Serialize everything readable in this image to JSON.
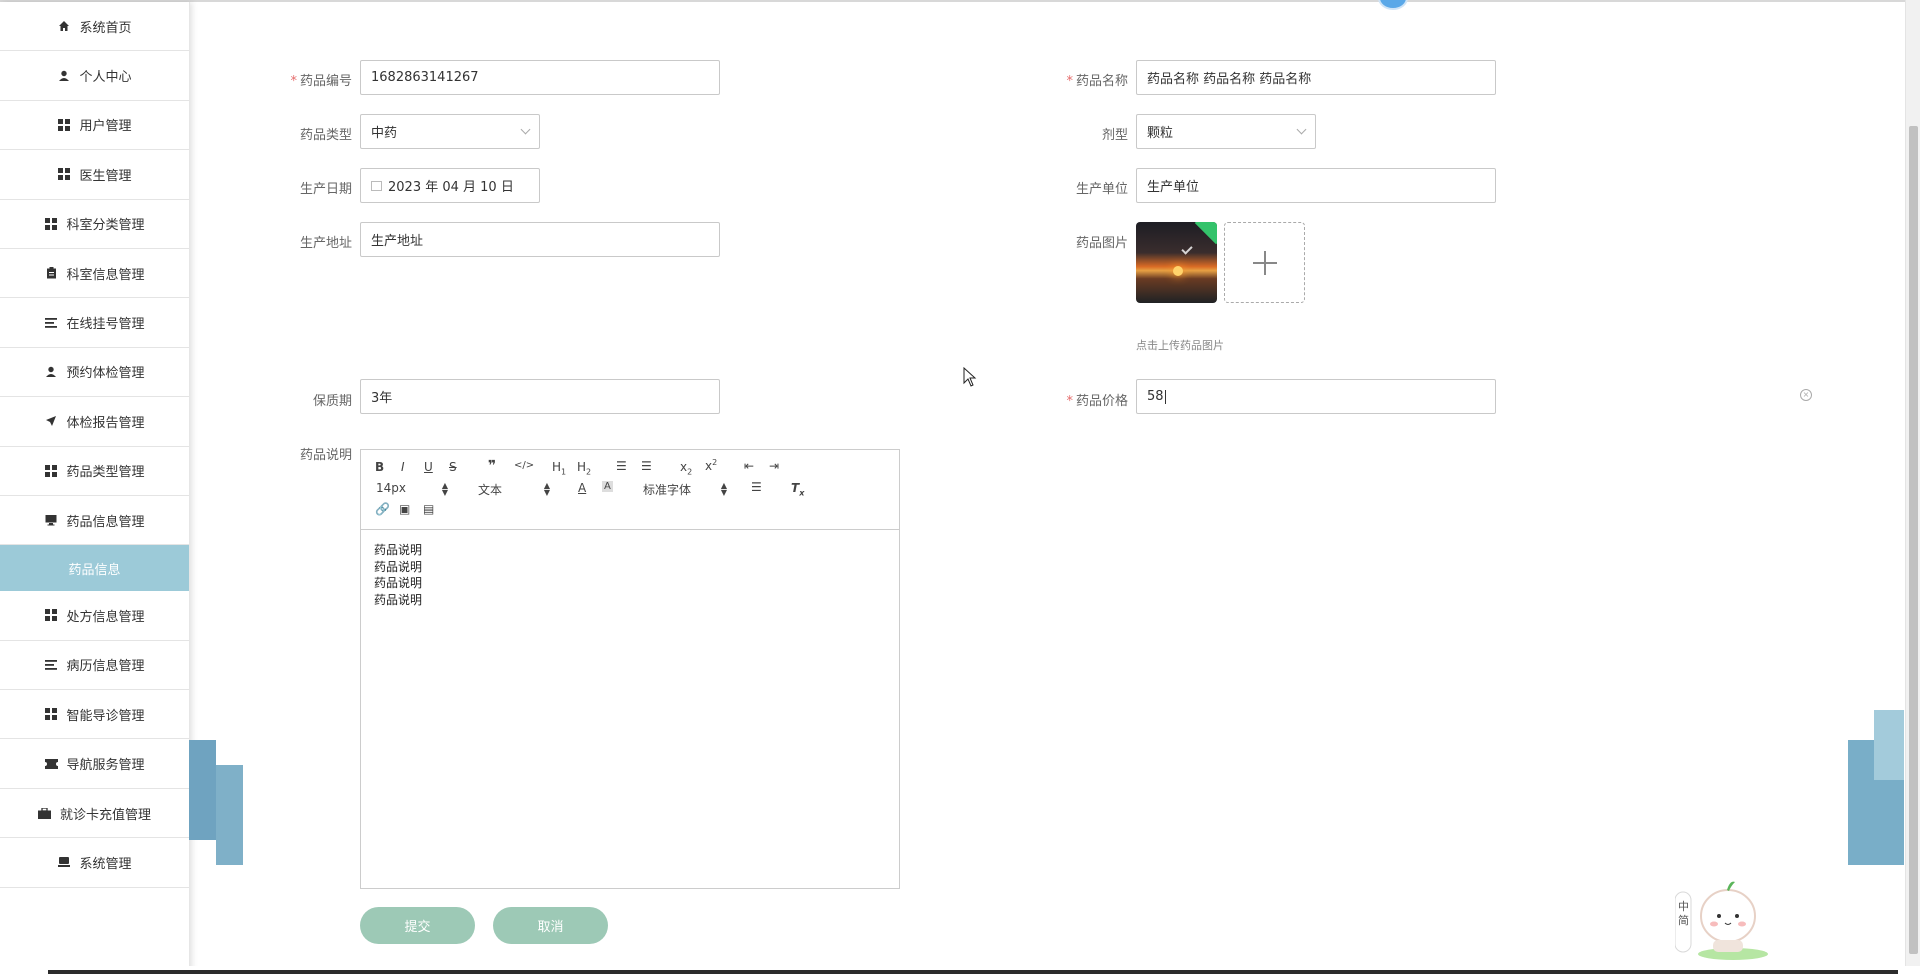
{
  "sidebar": {
    "items": [
      {
        "label": "系统首页",
        "icon": "home-icon"
      },
      {
        "label": "个人中心",
        "icon": "user-icon"
      },
      {
        "label": "用户管理",
        "icon": "grid-icon"
      },
      {
        "label": "医生管理",
        "icon": "grid-icon"
      },
      {
        "label": "科室分类管理",
        "icon": "grid-icon"
      },
      {
        "label": "科室信息管理",
        "icon": "clipboard-icon"
      },
      {
        "label": "在线挂号管理",
        "icon": "list-icon"
      },
      {
        "label": "预约体检管理",
        "icon": "user-icon"
      },
      {
        "label": "体检报告管理",
        "icon": "send-icon"
      },
      {
        "label": "药品类型管理",
        "icon": "grid-icon"
      },
      {
        "label": "药品信息管理",
        "icon": "monitor-icon"
      },
      {
        "label": "处方信息管理",
        "icon": "grid-icon"
      },
      {
        "label": "病历信息管理",
        "icon": "list-icon"
      },
      {
        "label": "智能导诊管理",
        "icon": "grid-icon"
      },
      {
        "label": "导航服务管理",
        "icon": "ticket-icon"
      },
      {
        "label": "就诊卡充值管理",
        "icon": "briefcase-icon"
      },
      {
        "label": "系统管理",
        "icon": "computer-icon"
      }
    ],
    "sub_item": "药品信息"
  },
  "form": {
    "code": {
      "label": "药品编号",
      "value": "1682863141267",
      "required": true
    },
    "name": {
      "label": "药品名称",
      "value": "药品名称 药品名称 药品名称",
      "required": true
    },
    "type": {
      "label": "药品类型",
      "value": "中药"
    },
    "dosage": {
      "label": "剂型",
      "value": "颗粒"
    },
    "date": {
      "label": "生产日期",
      "value": "2023 年 04 月 10 日"
    },
    "unit": {
      "label": "生产单位",
      "value": "生产单位"
    },
    "address": {
      "label": "生产地址",
      "value": "生产地址"
    },
    "image": {
      "label": "药品图片",
      "hint": "点击上传药品图片"
    },
    "shelf_life": {
      "label": "保质期",
      "value": "3年"
    },
    "price": {
      "label": "药品价格",
      "value": "58",
      "required": true
    },
    "description": {
      "label": "药品说明",
      "lines": [
        "药品说明",
        "药品说明",
        "药品说明",
        "药品说明"
      ]
    }
  },
  "editor_toolbar": {
    "font_size": "14px",
    "header_select": "文本",
    "font_select": "标准字体"
  },
  "buttons": {
    "submit": "提交",
    "cancel": "取消"
  },
  "mascot_text": "中简"
}
